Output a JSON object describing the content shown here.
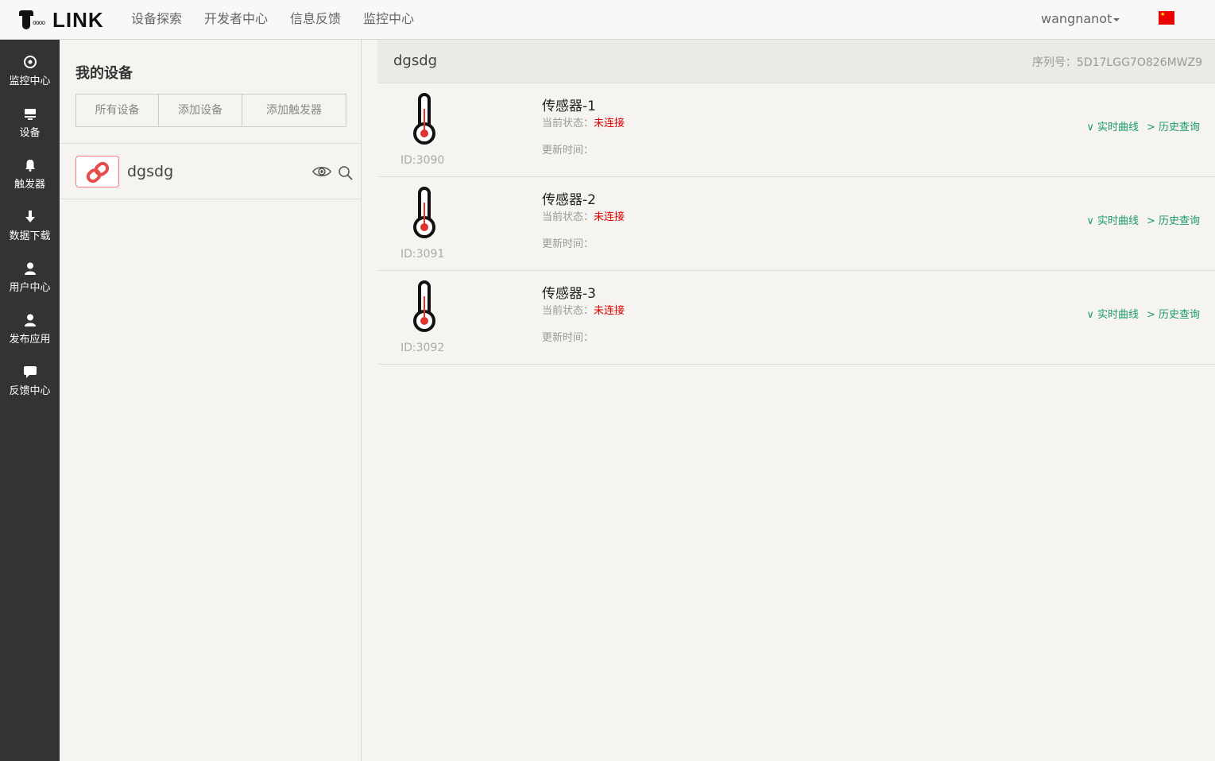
{
  "header": {
    "logo_text": "LINK",
    "logo_dots": "oooo",
    "nav": [
      "设备探索",
      "开发者中心",
      "信息反馈",
      "监控中心"
    ],
    "username": "wangnanot",
    "language_flag": "china-flag-icon"
  },
  "sidebar": {
    "items": [
      {
        "label": "监控中心",
        "icon": "target-icon"
      },
      {
        "label": "设备",
        "icon": "device-icon"
      },
      {
        "label": "触发器",
        "icon": "bell-icon"
      },
      {
        "label": "数据下载",
        "icon": "download-icon"
      },
      {
        "label": "用户中心",
        "icon": "user-icon"
      },
      {
        "label": "发布应用",
        "icon": "user-icon"
      },
      {
        "label": "反馈中心",
        "icon": "comment-icon"
      }
    ]
  },
  "devices_panel": {
    "title": "我的设备",
    "tabs": [
      "所有设备",
      "添加设备",
      "添加触发器"
    ],
    "devices": [
      {
        "name": "dgsdg",
        "icon": "link-icon"
      }
    ]
  },
  "main": {
    "device_name": "dgsdg",
    "serial_label": "序列号：",
    "serial": "5D17LGG7O826MWZ9",
    "sensors": [
      {
        "name": "传感器-1",
        "id": "ID:3090",
        "state_label": "当前状态：",
        "state": "未连接",
        "update_label": "更新时间：",
        "realtime": "∨ 实时曲线",
        "history": "> 历史查询"
      },
      {
        "name": "传感器-2",
        "id": "ID:3091",
        "state_label": "当前状态：",
        "state": "未连接",
        "update_label": "更新时间：",
        "realtime": "∨ 实时曲线",
        "history": "> 历史查询"
      },
      {
        "name": "传感器-3",
        "id": "ID:3092",
        "state_label": "当前状态：",
        "state": "未连接",
        "update_label": "更新时间：",
        "realtime": "∨ 实时曲线",
        "history": "> 历史查询"
      }
    ]
  },
  "colors": {
    "sidebar_bg": "#333333",
    "status_red": "#dd0000",
    "link_green": "#1a9a6a"
  }
}
